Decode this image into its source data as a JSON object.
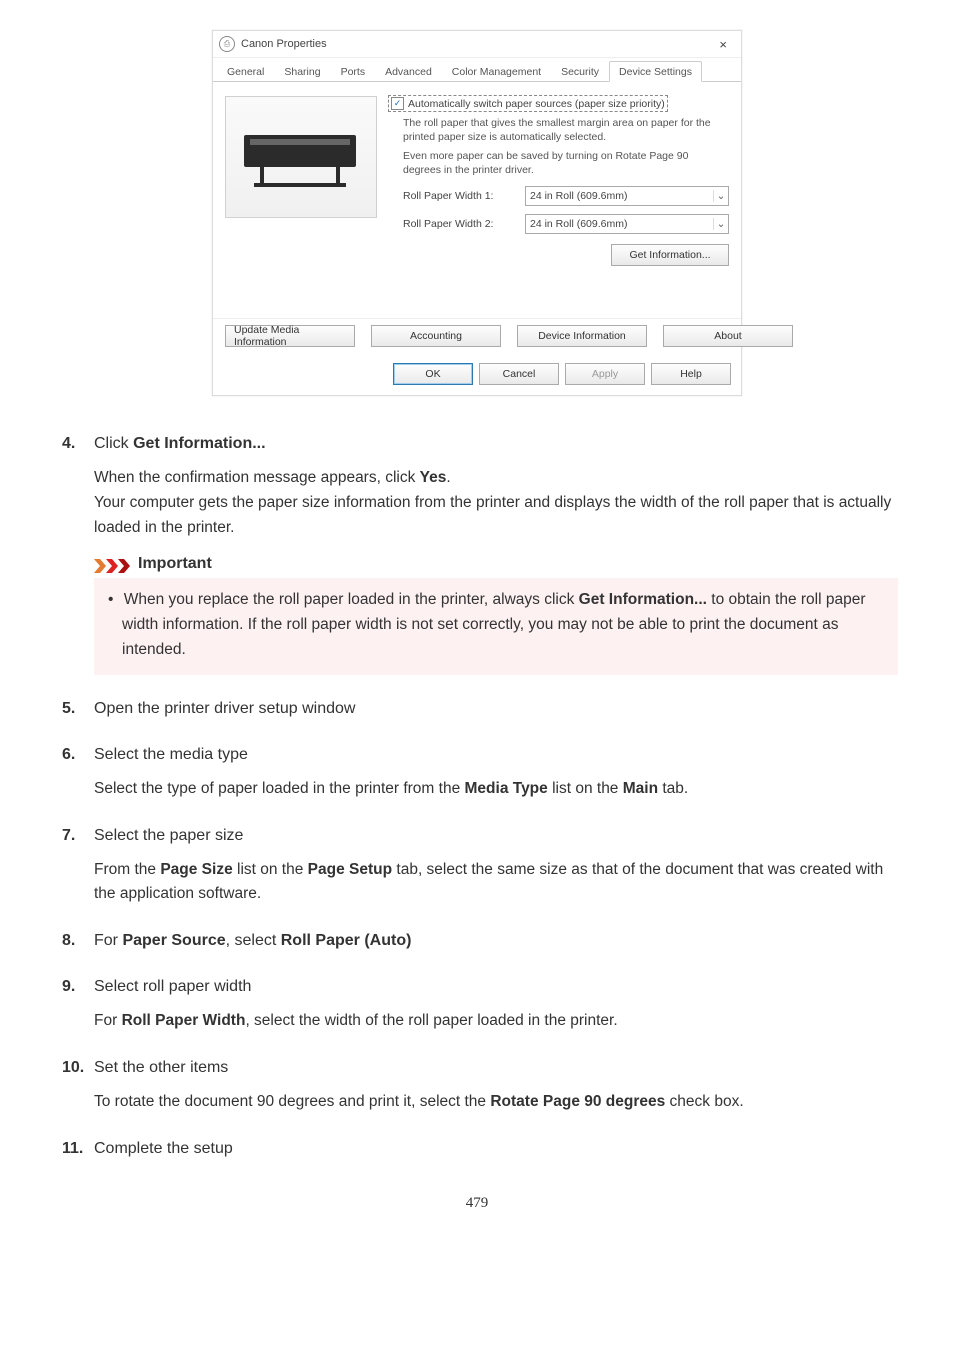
{
  "dialog": {
    "title": "Canon        Properties",
    "close_glyph": "×",
    "tabs": [
      "General",
      "Sharing",
      "Ports",
      "Advanced",
      "Color Management",
      "Security",
      "Device Settings"
    ],
    "active_tab_index": 6,
    "checkbox_label": "Automatically switch paper sources (paper size priority)",
    "help1": "The roll paper that gives the smallest margin area on paper for the printed paper size is automatically selected.",
    "help2": "Even more paper can be saved by turning on Rotate Page 90 degrees in the printer driver.",
    "roll1_label": "Roll Paper Width 1:",
    "roll1_value": "24 in Roll (609.6mm)",
    "roll2_label": "Roll Paper Width 2:",
    "roll2_value": "24 in Roll (609.6mm)",
    "getinfo_btn": "Get Information...",
    "lower_buttons": [
      "Update Media Information",
      "Accounting",
      "Device Information",
      "About"
    ],
    "footer_buttons": [
      "OK",
      "Cancel",
      "Apply",
      "Help"
    ]
  },
  "steps": {
    "s4": {
      "title_pre": "Click ",
      "title_bold": "Get Information...",
      "body_pre": "When the confirmation message appears, click ",
      "body_bold": "Yes",
      "body_post": ".",
      "body2": "Your computer gets the paper size information from the printer and displays the width of the roll paper that is actually loaded in the printer."
    },
    "important": {
      "header": "Important",
      "bullet_pre": "When you replace the roll paper loaded in the printer, always click ",
      "bullet_bold": "Get Information...",
      "bullet_post": " to obtain the roll paper width information. If the roll paper width is not set correctly, you may not be able to print the document as intended."
    },
    "s5": {
      "title": "Open the printer driver setup window"
    },
    "s6": {
      "title": "Select the media type",
      "body_pre": "Select the type of paper loaded in the printer from the ",
      "b1": "Media Type",
      "mid": " list on the ",
      "b2": "Main",
      "post": " tab."
    },
    "s7": {
      "title": "Select the paper size",
      "body_pre": "From the ",
      "b1": "Page Size",
      "mid": " list on the ",
      "b2": "Page Setup",
      "post": " tab, select the same size as that of the document that was created with the application software."
    },
    "s8": {
      "pre": "For ",
      "b1": "Paper Source",
      "mid": ", select ",
      "b2": "Roll Paper (Auto)"
    },
    "s9": {
      "title": "Select roll paper width",
      "body_pre": "For ",
      "b1": "Roll Paper Width",
      "post": ", select the width of the roll paper loaded in the printer."
    },
    "s10": {
      "title": "Set the other items",
      "body_pre": "To rotate the document 90 degrees and print it, select the ",
      "b1": "Rotate Page 90 degrees",
      "post": " check box."
    },
    "s11": {
      "title": "Complete the setup"
    }
  },
  "page_number": "479"
}
